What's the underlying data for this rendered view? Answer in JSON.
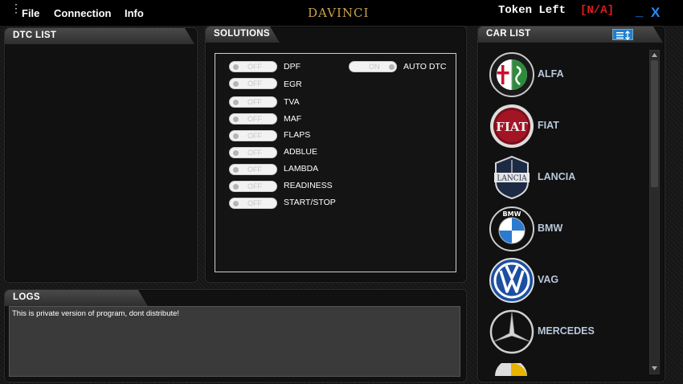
{
  "menu": {
    "items": [
      "File",
      "Connection",
      "Info"
    ]
  },
  "brand": "DAVINCI",
  "token": {
    "label": "Token Left",
    "value": "[N/A]"
  },
  "window": {
    "minimize": "_",
    "close": "X"
  },
  "dtc_panel": {
    "title": "DTC LIST"
  },
  "solutions": {
    "title": "SOLUTIONS",
    "items": [
      {
        "label": "DPF",
        "state": "OFF"
      },
      {
        "label": "EGR",
        "state": "OFF"
      },
      {
        "label": "TVA",
        "state": "OFF"
      },
      {
        "label": "MAF",
        "state": "OFF"
      },
      {
        "label": "FLAPS",
        "state": "OFF"
      },
      {
        "label": "ADBLUE",
        "state": "OFF"
      },
      {
        "label": "LAMBDA",
        "state": "OFF"
      },
      {
        "label": "READINESS",
        "state": "OFF"
      },
      {
        "label": "START/STOP",
        "state": "OFF"
      }
    ],
    "auto_dtc": {
      "label": "AUTO DTC",
      "state": "ON"
    }
  },
  "logs": {
    "title": "LOGS",
    "text": "This is private version of program, dont distribute!"
  },
  "car_list": {
    "title": "CAR LIST",
    "cars": [
      "ALFA",
      "FIAT",
      "LANCIA",
      "BMW",
      "VAG",
      "MERCEDES"
    ]
  },
  "colors": {
    "accent": "#1e90ff",
    "brand": "#c8a24a",
    "token_value": "#e01e1e",
    "car_name": "#b8c8da"
  }
}
